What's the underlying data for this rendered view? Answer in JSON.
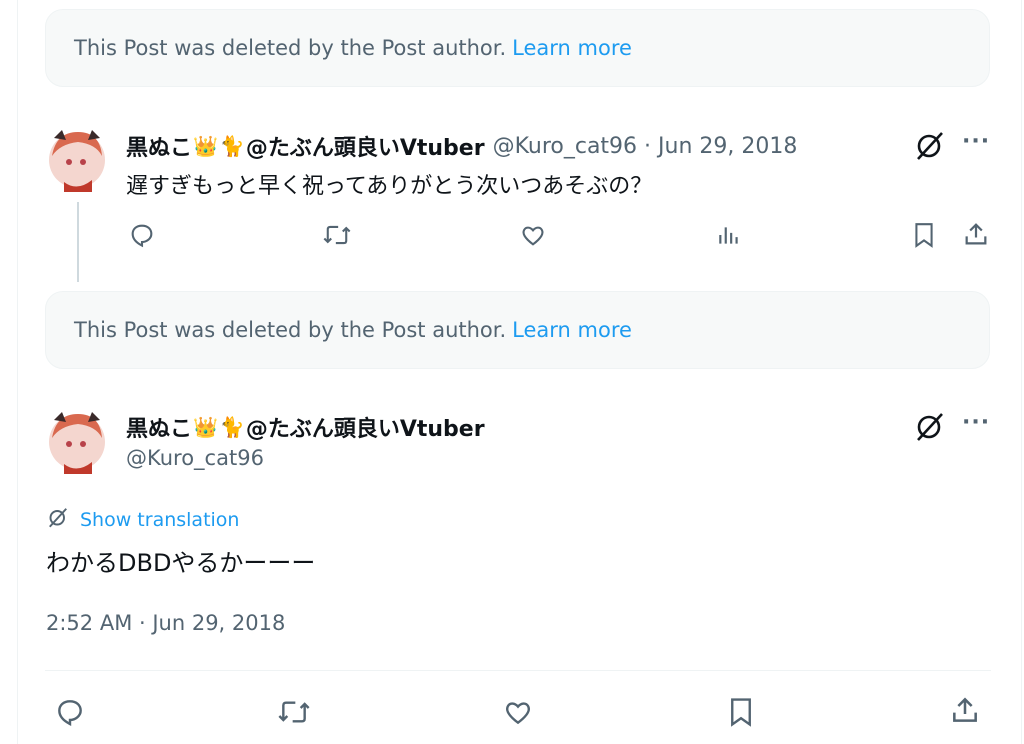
{
  "deleted_notice": {
    "text": "This Post was deleted by the Post author.",
    "link": "Learn more"
  },
  "reply": {
    "display_name": "黒ぬこ",
    "emoji_crown": "👑",
    "emoji_cat": "🐈",
    "display_name_suffix": "@たぶん頭良いVtuber",
    "handle_date": "@Kuro_cat96 · Jun 29, 2018",
    "text": "遅すぎもっと早く祝ってありがとう次いつあそぶの？"
  },
  "main_post": {
    "display_name": "黒ぬこ",
    "emoji_crown": "👑",
    "emoji_cat": "🐈",
    "display_name_suffix": "@たぶん頭良いVtuber",
    "handle": "@Kuro_cat96",
    "show_translation": "Show translation",
    "text": "わかるDBDやるかーーー",
    "timestamp": "2:52 AM · Jun 29, 2018"
  },
  "more_glyph": "···",
  "colors": {
    "accent": "#1d9bf0",
    "muted": "#536471",
    "text": "#0f1419"
  }
}
